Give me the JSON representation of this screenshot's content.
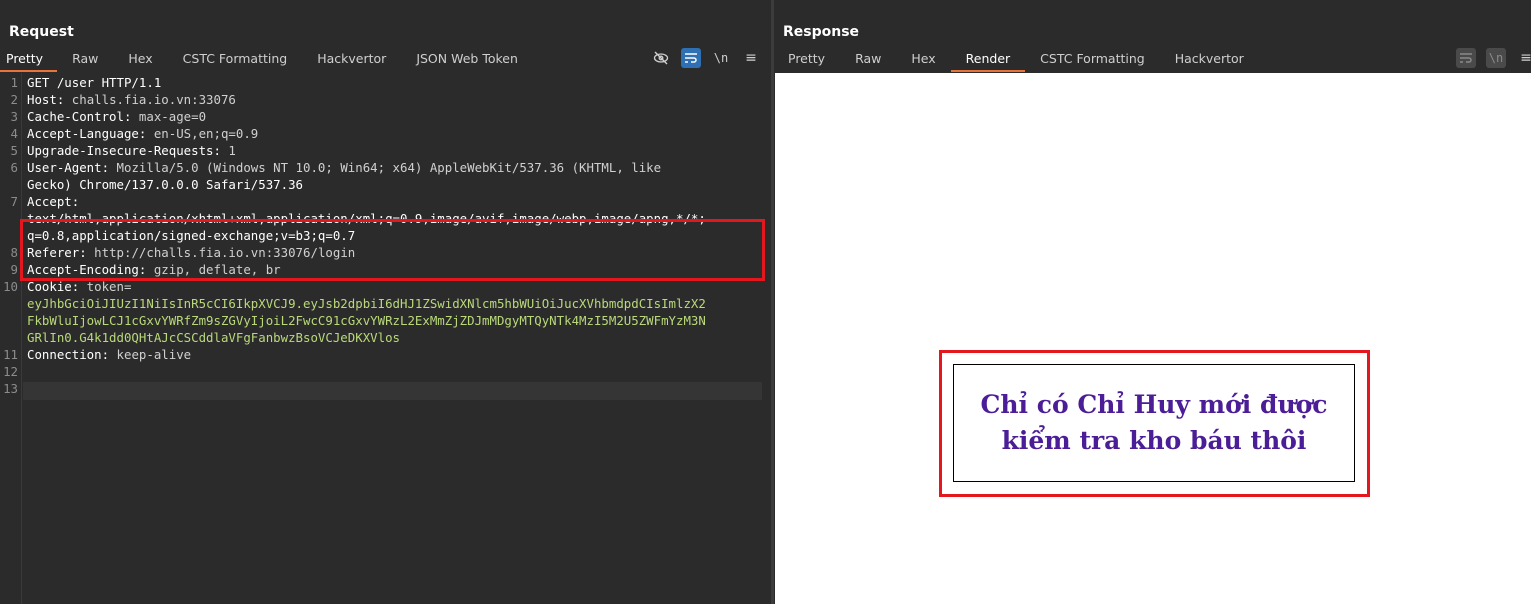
{
  "request": {
    "title": "Request",
    "tabs": [
      "Pretty",
      "Raw",
      "Hex",
      "CSTC Formatting",
      "Hackvertor",
      "JSON Web Token"
    ],
    "active_tab": "Pretty",
    "lines": [
      {
        "n": "1",
        "key": "",
        "val": "GET /user HTTP/1.1"
      },
      {
        "n": "2",
        "key": "Host:",
        "val": " challs.fia.io.vn:33076"
      },
      {
        "n": "3",
        "key": "Cache-Control:",
        "val": " max-age=0"
      },
      {
        "n": "4",
        "key": "Accept-Language:",
        "val": " en-US,en;q=0.9"
      },
      {
        "n": "5",
        "key": "Upgrade-Insecure-Requests:",
        "val": " 1"
      },
      {
        "n": "6",
        "key": "User-Agent:",
        "val": " Mozilla/5.0 (Windows NT 10.0; Win64; x64) AppleWebKit/537.36 (KHTML, like"
      },
      {
        "n": "",
        "key": "",
        "val": "Gecko) Chrome/137.0.0.0 Safari/537.36"
      },
      {
        "n": "7",
        "key": "Accept:",
        "val": ""
      },
      {
        "n": "",
        "key": "",
        "val": "text/html,application/xhtml+xml,application/xml;q=0.9,image/avif,image/webp,image/apng,*/*;"
      },
      {
        "n": "",
        "key": "",
        "val": "q=0.8,application/signed-exchange;v=b3;q=0.7"
      },
      {
        "n": "8",
        "key": "Referer:",
        "val": " http://challs.fia.io.vn:33076/login"
      },
      {
        "n": "9",
        "key": "Accept-Encoding:",
        "val": " gzip, deflate, br"
      },
      {
        "n": "10",
        "key": "Cookie:",
        "val": " token="
      },
      {
        "n": "",
        "key": "",
        "tok": "eyJhbGciOiJIUzI1NiIsInR5cCI6IkpXVCJ9.eyJsb2dpbiI6dHJ1ZSwidXNlcm5hbWUiOiJucXVhbmdpdCIsImlzX2"
      },
      {
        "n": "",
        "key": "",
        "tok": "FkbWluIjowLCJ1cGxvYWRfZm9sZGVyIjoiL2FwcC91cGxvYWRzL2ExMmZjZDJmMDgyMTQyNTk4MzI5M2U5ZWFmYzM3N"
      },
      {
        "n": "",
        "key": "",
        "tok": "GRlIn0.G4k1dd0QHtAJcCSCddlaVFgFanbwzBsoVCJeDKXVlos"
      },
      {
        "n": "11",
        "key": "Connection:",
        "val": " keep-alive"
      },
      {
        "n": "12",
        "key": "",
        "val": ""
      },
      {
        "n": "13",
        "key": "",
        "val": ""
      }
    ]
  },
  "response": {
    "title": "Response",
    "tabs": [
      "Pretty",
      "Raw",
      "Hex",
      "Render",
      "CSTC Formatting",
      "Hackvertor"
    ],
    "active_tab": "Render",
    "message": "Chỉ có Chỉ Huy mới được kiểm tra kho báu thôi"
  },
  "colors": {
    "accent": "#e8743b",
    "highlight": "#e3171d",
    "message": "#4b1d96",
    "token": "#b9d97a"
  },
  "icons": {
    "request": [
      "eye-off-icon",
      "wrap-icon",
      "newline-icon",
      "menu-icon"
    ],
    "response": [
      "wrap-icon",
      "newline-icon",
      "menu-icon"
    ]
  }
}
